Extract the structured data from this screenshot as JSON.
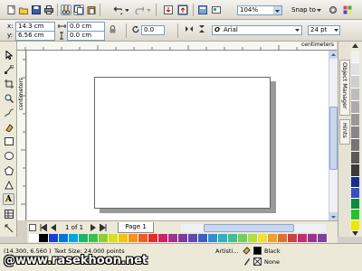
{
  "toolbar": {
    "zoom": "104%",
    "snap_to": "Snap to"
  },
  "property_bar": {
    "x_label": "x:",
    "x_value": "14.3 cm",
    "y_label": "y:",
    "y_value": "6.56 cm",
    "w_value": "0.0 cm",
    "h_value": "0.0 cm",
    "angle": "0.0",
    "font": "Arial",
    "font_size": "24 pt"
  },
  "ruler": {
    "unit": "centimeters"
  },
  "dockers": {
    "object_manager": "Object Manager",
    "hints": "Hints"
  },
  "page_nav": {
    "count": "1 of 1",
    "tab": "Page 1"
  },
  "status": {
    "coords": "(14.300, 6.560 )",
    "info": "Text Size: 24.000 points",
    "artistic": "Artisti...",
    "fill_name": "Black",
    "outline_name": "None"
  },
  "watermark": "@www.rasekhoon.net",
  "colors": {
    "accent": "#316ac5",
    "palette": [
      "#000000",
      "#808080",
      "#ff0000",
      "#ff8000",
      "#ffff00",
      "#00ff00",
      "#00ffff",
      "#0000ff",
      "#ff00ff",
      "#ffffff"
    ]
  }
}
